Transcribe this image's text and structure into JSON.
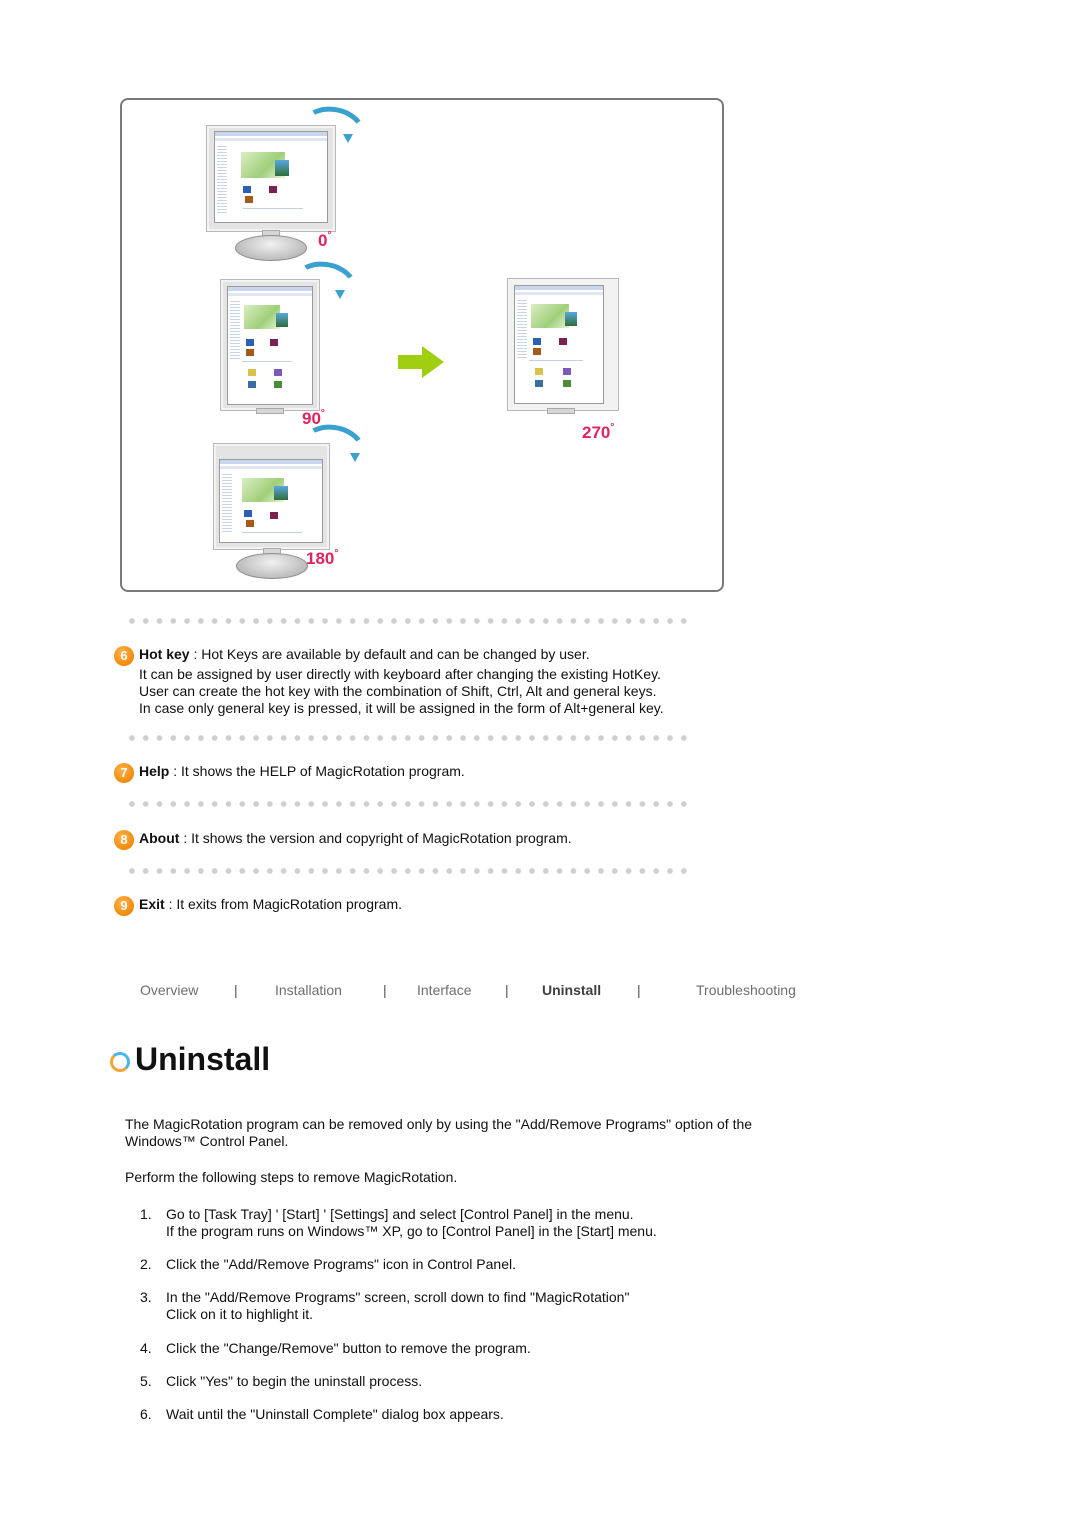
{
  "illustration": {
    "angles": [
      "0",
      "90",
      "180",
      "270"
    ],
    "degree_symbol": "°",
    "colors": {
      "angle_label": "#e0245e",
      "rotation_arrow": "#3aa0cf",
      "transition_arrow": "#9fcf0e"
    }
  },
  "features": [
    {
      "number": "6",
      "name": "Hot key",
      "description": " : Hot Keys are available by default and can be changed by user.",
      "details": [
        "It can be assigned by user directly with keyboard after changing the existing HotKey.",
        "User can create the hot key with the combination of Shift, Ctrl, Alt and general keys.",
        "In case only general key is pressed, it will be assigned in the form of Alt+general key."
      ]
    },
    {
      "number": "7",
      "name": "Help",
      "description": " : It shows the HELP of MagicRotation program."
    },
    {
      "number": "8",
      "name": "About",
      "description": " : It shows the version and copyright of MagicRotation program."
    },
    {
      "number": "9",
      "name": "Exit",
      "description": " : It exits from MagicRotation program."
    }
  ],
  "nav": {
    "items": [
      "Overview",
      "Installation",
      "Interface",
      "Uninstall",
      "Troubleshooting"
    ],
    "active": "Uninstall",
    "separator": "|"
  },
  "section": {
    "title": "Uninstall",
    "intro_line1": "The MagicRotation program can be removed only by using the \"Add/Remove Programs\" option of the",
    "intro_line2": "Windows™ Control Panel.",
    "lead": "Perform the following steps to remove MagicRotation.",
    "steps": [
      {
        "num": "1.",
        "lines": [
          "Go to [Task Tray] ' [Start] ' [Settings] and select [Control Panel] in the menu.",
          "If the program runs on Windows™ XP, go to [Control Panel] in the [Start] menu."
        ]
      },
      {
        "num": "2.",
        "lines": [
          "Click the \"Add/Remove Programs\" icon in Control Panel."
        ]
      },
      {
        "num": "3.",
        "lines": [
          "In the \"Add/Remove Programs\" screen, scroll down to find \"MagicRotation\"",
          "Click on it to highlight it."
        ]
      },
      {
        "num": "4.",
        "lines": [
          "Click the \"Change/Remove\" button to remove the program."
        ]
      },
      {
        "num": "5.",
        "lines": [
          "Click \"Yes\" to begin the uninstall process."
        ]
      },
      {
        "num": "6.",
        "lines": [
          "Wait until the \"Uninstall Complete\" dialog box appears."
        ]
      }
    ]
  }
}
